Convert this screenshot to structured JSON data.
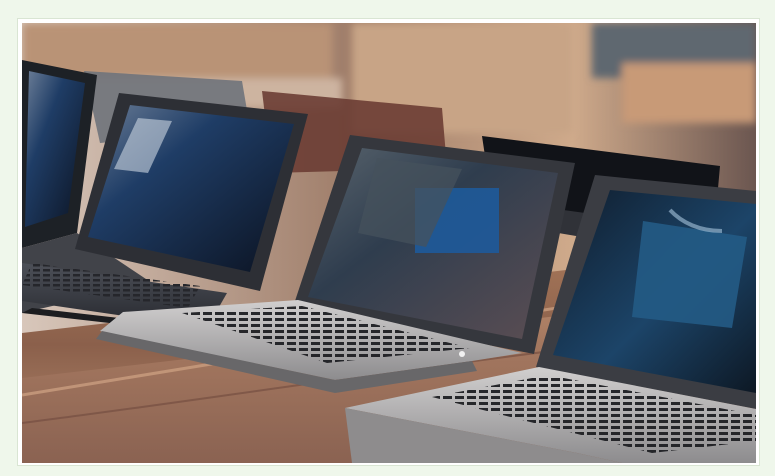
{
  "image": {
    "alt": "",
    "subject": "laptops-on-wooden-table",
    "colors": {
      "page_background": "#eff7eb",
      "wood_light": "#b4866a",
      "wood_mid": "#8f6550",
      "wood_dark": "#5f4336",
      "laptop_shell": "#3a3b40",
      "laptop_silver": "#b8b6b6",
      "screen_blue": "#1f4f73",
      "screen_dark": "#141d2a"
    }
  }
}
